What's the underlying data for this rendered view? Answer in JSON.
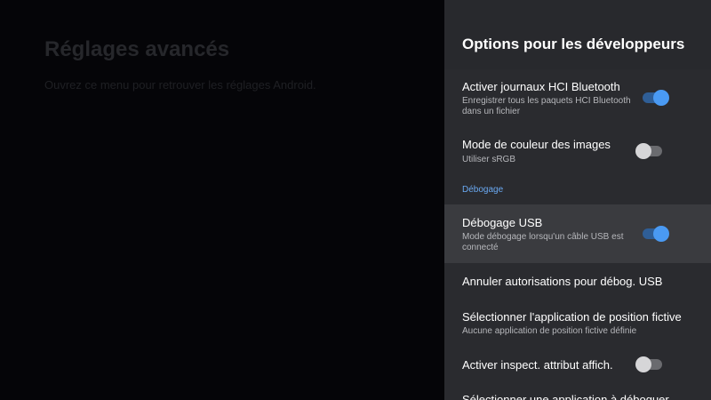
{
  "background": {
    "title": "Réglages avancés",
    "subtitle": "Ouvrez ce menu pour retrouver les réglages Android."
  },
  "panel": {
    "title": "Options pour les développeurs",
    "items": [
      {
        "title": "Activer journaux HCI Bluetooth",
        "summary": "Enregistrer tous les paquets HCI Bluetooth dans un fichier",
        "toggle": true
      },
      {
        "title": "Mode de couleur des images",
        "summary": "Utiliser sRGB",
        "toggle": false
      },
      {
        "section": "Débogage"
      },
      {
        "title": "Débogage USB",
        "summary": "Mode débogage lorsqu'un câble USB est connecté",
        "toggle": true,
        "selected": true
      },
      {
        "title": "Annuler autorisations pour débog. USB"
      },
      {
        "title": "Sélectionner l'application de position fictive",
        "summary": "Aucune application de position fictive définie"
      },
      {
        "title": "Activer inspect. attribut affich.",
        "toggle": false
      },
      {
        "title": "Sélectionner une application à déboguer"
      }
    ]
  },
  "colors": {
    "accent": "#4a9af3",
    "panel_background": "#2a2b2f",
    "selected_row": "#3a3b3f",
    "section_label": "#6aa9f2"
  }
}
